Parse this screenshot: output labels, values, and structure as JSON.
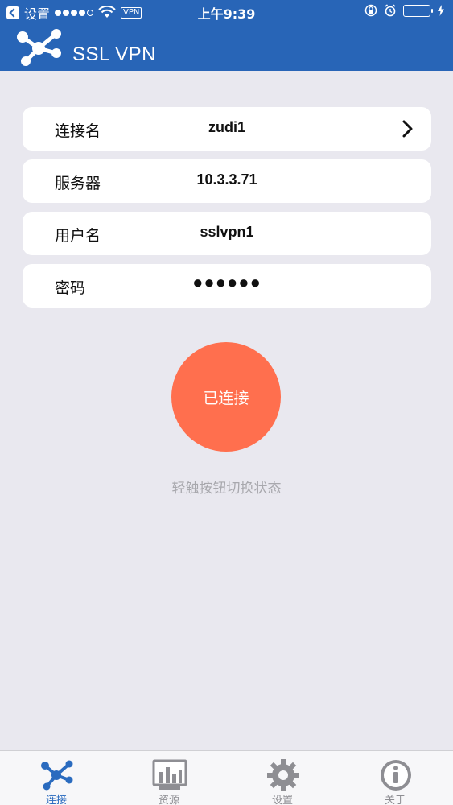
{
  "status_bar": {
    "back_label": "设置",
    "vpn": "VPN",
    "time": "上午9:39"
  },
  "header": {
    "title": "SSL VPN",
    "icon": "network-nodes-icon"
  },
  "form": {
    "rows": [
      {
        "label": "连接名",
        "value": "zudi1"
      },
      {
        "label": "服务器",
        "value": "10.3.3.71"
      },
      {
        "label": "用户名",
        "value": "sslvpn1"
      },
      {
        "label": "密码",
        "value": "●●●●●●"
      }
    ]
  },
  "connect": {
    "button_label": "已连接",
    "hint": "轻触按钮切换状态",
    "color": "#ff6f4e"
  },
  "tabs": [
    {
      "label": "连接",
      "icon": "network-nodes-icon",
      "active": true
    },
    {
      "label": "资源",
      "icon": "chart-icon",
      "active": false
    },
    {
      "label": "设置",
      "icon": "gear-icon",
      "active": false
    },
    {
      "label": "关于",
      "icon": "info-icon",
      "active": false
    }
  ],
  "colors": {
    "header": "#2865b7",
    "accent": "#2a6bbf",
    "background": "#e9e8ef"
  }
}
